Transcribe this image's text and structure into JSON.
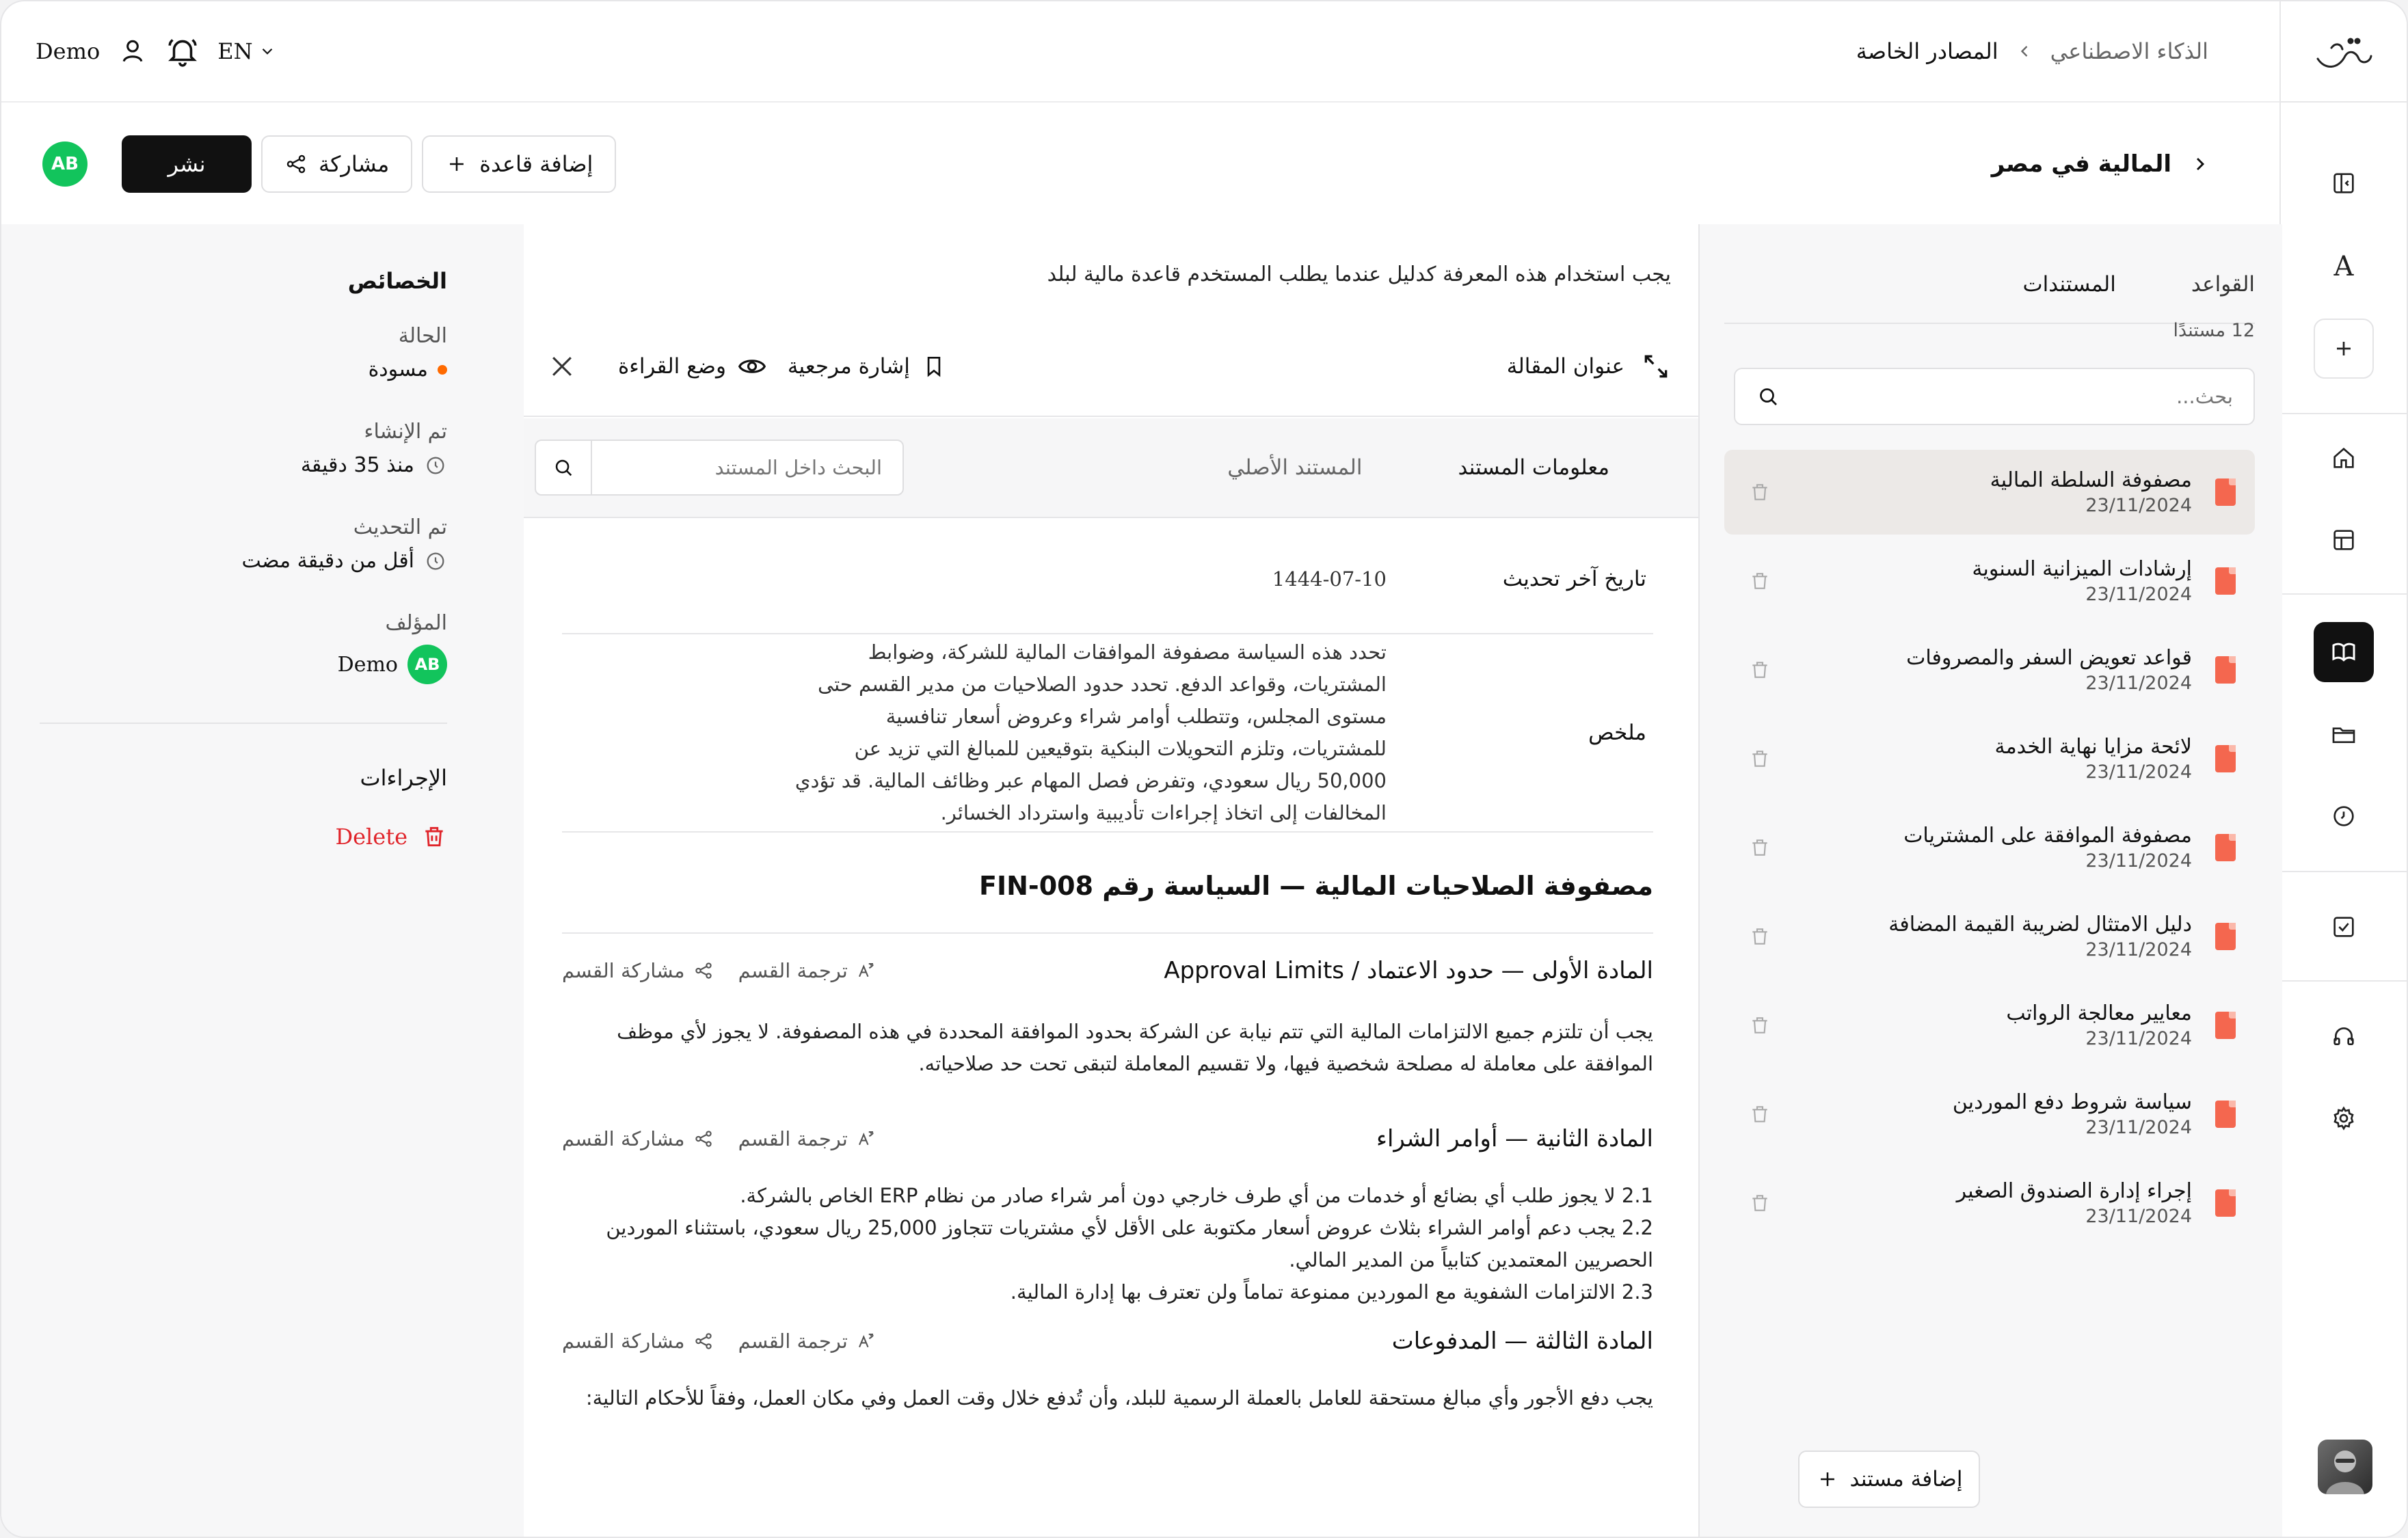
{
  "header": {
    "user_name": "Demo",
    "language": "EN",
    "breadcrumb": [
      "الذكاء الاصطناعي",
      "المصادر الخاصة"
    ]
  },
  "titlebar": {
    "title": "المالية في مصر",
    "avatar_initials": "AB",
    "publish_label": "نشر",
    "share_label": "مشاركة",
    "add_rule_label": "إضافة قاعدة"
  },
  "properties": {
    "heading": "الخصائص",
    "status_label": "الحالة",
    "status_value": "مسودة",
    "created_label": "تم الإنشاء",
    "created_value": "منذ 35 دقيقة",
    "updated_label": "تم التحديث",
    "updated_value": "أقل من دقيقة مضت",
    "author_label": "المؤلف",
    "author_name": "Demo",
    "author_initials": "AB",
    "actions_label": "الإجراءات",
    "delete_label": "Delete",
    "status_color": "#ff6a00",
    "delete_color": "#e0242a"
  },
  "document": {
    "instruction": "يجب استخدام هذه المعرفة كدليل عندما يطلب المستخدم قاعدة مالية لبلد",
    "article_title_label": "عنوان المقالة",
    "bookmark_label": "إشارة مرجعية",
    "reading_mode_label": "وضع القراءة",
    "tab_info": "معلومات المستند",
    "tab_original": "المستند الأصلي",
    "search_placeholder": "البحث داخل المستند",
    "last_update_label": "تاريخ آخر تحديث",
    "last_update_value": "1444-07-10",
    "summary_label": "ملخص",
    "summary_value": "تحدد هذه السياسة مصفوفة الموافقات المالية للشركة، وضوابط المشتريات، وقواعد الدفع. تحدد حدود الصلاحيات من مدير القسم حتى مستوى المجلس، وتتطلب أوامر شراء وعروض أسعار تنافسية للمشتريات، وتلزم التحويلات البنكية بتوقيعين للمبالغ التي تزيد عن 50,000 ريال سعودي، وتفرض فصل المهام عبر وظائف المالية. قد تؤدي المخالفات إلى اتخاذ إجراءات تأديبية واسترداد الخسائر.",
    "policy_title": "مصفوفة الصلاحيات المالية — السياسة رقم FIN-008",
    "translate_label": "ترجمة القسم",
    "share_section_label": "مشاركة القسم",
    "articles": [
      {
        "title": "المادة الأولى — حدود الاعتماد / Approval Limits",
        "body": "يجب أن تلتزم جميع الالتزامات المالية التي تتم نيابة عن الشركة بحدود الموافقة المحددة في هذه المصفوفة. لا يجوز لأي موظف الموافقة على معاملة له مصلحة شخصية فيها، ولا تقسيم المعاملة لتبقى تحت حد صلاحياته."
      },
      {
        "title": "المادة الثانية — أوامر الشراء",
        "body_lines": [
          "2.1 لا يجوز طلب أي بضائع أو خدمات من أي طرف خارجي دون أمر شراء صادر من نظام ERP الخاص بالشركة.",
          "2.2 يجب دعم أوامر الشراء بثلاث عروض أسعار مكتوبة على الأقل لأي مشتريات تتجاوز 25,000 ريال سعودي، باستثناء الموردين الحصريين المعتمدين كتابياً من المدير المالي.",
          "2.3 الالتزامات الشفوية مع الموردين ممنوعة تماماً ولن تعترف بها إدارة المالية."
        ]
      },
      {
        "title": "المادة الثالثة — المدفوعات",
        "body": "يجب دفع الأجور وأي مبالغ مستحقة للعامل بالعملة الرسمية للبلد، وأن تُدفع خلال وقت العمل وفي مكان العمل، وفقاً للأحكام التالية:"
      }
    ]
  },
  "docs_sidebar": {
    "tab_rules": "القواعد",
    "tab_documents": "المستندات",
    "count_label": "12 مستندًا",
    "search_placeholder": "بحث...",
    "add_document_label": "إضافة مستند",
    "items": [
      {
        "name": "مصفوفة السلطة المالية",
        "date": "23/11/2024"
      },
      {
        "name": "إرشادات الميزانية السنوية",
        "date": "23/11/2024"
      },
      {
        "name": "قواعد تعويض السفر والمصروفات",
        "date": "23/11/2024"
      },
      {
        "name": "لائحة مزايا نهاية الخدمة",
        "date": "23/11/2024"
      },
      {
        "name": "مصفوفة الموافقة على المشتريات",
        "date": "23/11/2024"
      },
      {
        "name": "دليل الامتثال لضريبة القيمة المضافة",
        "date": "23/11/2024"
      },
      {
        "name": "معايير معالجة الرواتب",
        "date": "23/11/2024"
      },
      {
        "name": "سياسة شروط دفع الموردين",
        "date": "23/11/2024"
      },
      {
        "name": "إجراء إدارة الصندوق الصغير",
        "date": "23/11/2024"
      }
    ]
  },
  "rail": {
    "letter_icon": "A",
    "icons": [
      "sidebar-toggle-icon",
      "font-icon",
      "plus-icon",
      "home-icon",
      "table-icon",
      "book-icon",
      "folder-icon",
      "clock-icon",
      "checkbox-icon",
      "headphones-icon",
      "gear-icon"
    ]
  },
  "colors": {
    "accent_dark": "#111111",
    "avatar_green": "#12c45c",
    "pdf_red": "#f4674f"
  }
}
